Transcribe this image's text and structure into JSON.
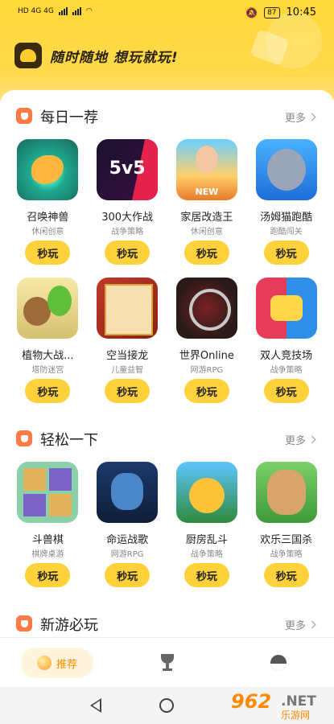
{
  "status": {
    "left": "HD 4G 4G",
    "battery": "87",
    "time": "10:45"
  },
  "header": {
    "slogan": "随时随地 想玩就玩!"
  },
  "sections": [
    {
      "title": "每日一荐",
      "more": "更多",
      "games": [
        {
          "name": "召唤神兽",
          "cat": "休闲创意",
          "btn": "秒玩"
        },
        {
          "name": "300大作战",
          "cat": "战争策略",
          "btn": "秒玩",
          "art": "5v5"
        },
        {
          "name": "家居改造王",
          "cat": "休闲创意",
          "btn": "秒玩"
        },
        {
          "name": "汤姆猫跑酷",
          "cat": "跑酷闯关",
          "btn": "秒玩"
        },
        {
          "name": "植物大战...",
          "cat": "塔防迷宫",
          "btn": "秒玩"
        },
        {
          "name": "空当接龙",
          "cat": "儿童益智",
          "btn": "秒玩"
        },
        {
          "name": "世界Online",
          "cat": "网游RPG",
          "btn": "秒玩"
        },
        {
          "name": "双人竞技场",
          "cat": "战争策略",
          "btn": "秒玩"
        }
      ]
    },
    {
      "title": "轻松一下",
      "more": "更多",
      "games": [
        {
          "name": "斗兽棋",
          "cat": "棋牌桌游",
          "btn": "秒玩"
        },
        {
          "name": "命运战歌",
          "cat": "网游RPG",
          "btn": "秒玩"
        },
        {
          "name": "厨房乱斗",
          "cat": "战争策略",
          "btn": "秒玩"
        },
        {
          "name": "欢乐三国杀",
          "cat": "战争策略",
          "btn": "秒玩"
        }
      ]
    },
    {
      "title": "新游必玩",
      "more": "更多"
    }
  ],
  "bottom_nav": {
    "recommend": "推荐"
  },
  "watermark": {
    "num": "962",
    "net": ".NET",
    "sub": "乐游网"
  }
}
